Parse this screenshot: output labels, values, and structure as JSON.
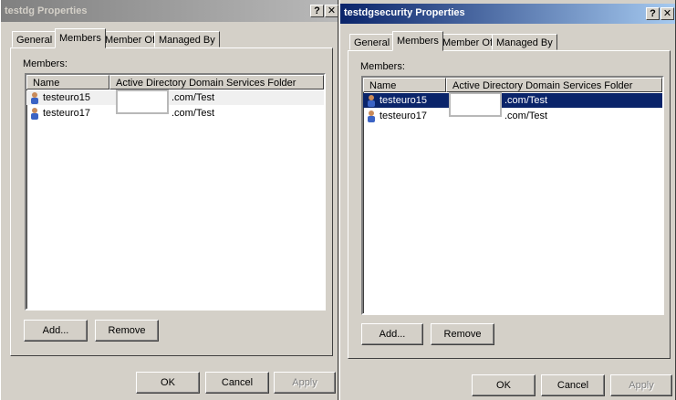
{
  "dialogs": [
    {
      "title": "testdg Properties",
      "active": false,
      "title_buttons": {
        "help": "?",
        "close": "✕"
      },
      "tabs": [
        "General",
        "Members",
        "Member Of",
        "Managed By"
      ],
      "selected_tab": "Members",
      "members_label": "Members:",
      "columns": [
        "Name",
        "Active Directory Domain Services Folder"
      ],
      "rows": [
        {
          "name": "testeuro15",
          "folder": ".com/Test",
          "selected": false
        },
        {
          "name": "testeuro17",
          "folder": ".com/Test",
          "selected": false
        }
      ],
      "buttons": {
        "add": "Add...",
        "remove": "Remove",
        "ok": "OK",
        "cancel": "Cancel",
        "apply": "Apply"
      }
    },
    {
      "title": "testdgsecurity Properties",
      "active": true,
      "title_buttons": {
        "help": "?",
        "close": "✕"
      },
      "tabs": [
        "General",
        "Members",
        "Member Of",
        "Managed By"
      ],
      "selected_tab": "Members",
      "members_label": "Members:",
      "columns": [
        "Name",
        "Active Directory Domain Services Folder"
      ],
      "rows": [
        {
          "name": "testeuro15",
          "folder": ".com/Test",
          "selected": true
        },
        {
          "name": "testeuro17",
          "folder": ".com/Test",
          "selected": false
        }
      ],
      "buttons": {
        "add": "Add...",
        "remove": "Remove",
        "ok": "OK",
        "cancel": "Cancel",
        "apply": "Apply"
      }
    }
  ],
  "colors": {
    "face": "#d4d0c8",
    "active_title": "#0a246a",
    "inactive_title": "#808080",
    "selection": "#0a246a"
  },
  "icons": [
    "user-icon",
    "help-icon",
    "close-icon"
  ]
}
